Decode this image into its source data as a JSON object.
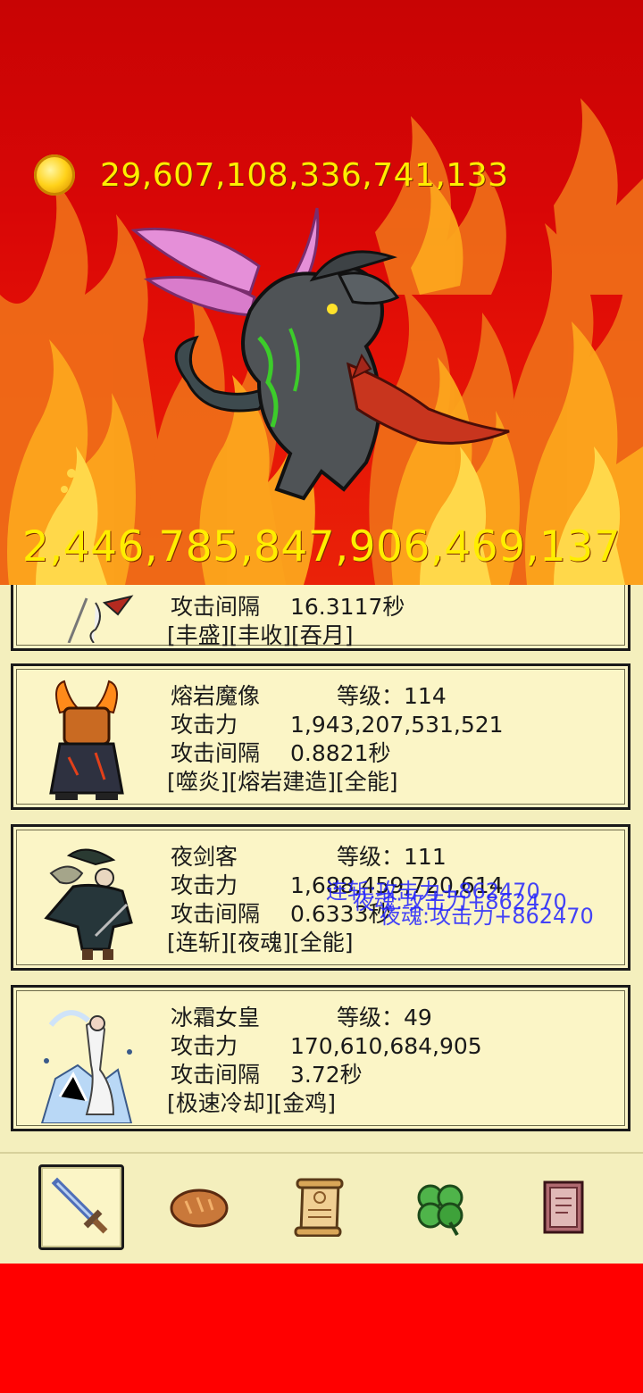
{
  "gold": {
    "icon": "gold-coin-icon",
    "value": "29,607,108,336,741,133"
  },
  "boss": {
    "hp": "2,446,785,847,906,469,137",
    "icon": "winged-demon-boss-icon"
  },
  "heroes": [
    {
      "name": "",
      "level": "",
      "attack": "",
      "interval_label": "攻击间隔",
      "interval": "16.3117秒",
      "tags": "[丰盛][丰收][吞月]",
      "icon": "reaper-hero-icon"
    },
    {
      "name": "熔岩魔像",
      "level_label": "等级：",
      "level": "114",
      "attack_label": "攻击力",
      "attack": "1,943,207,531,521",
      "interval_label": "攻击间隔",
      "interval": "0.8821秒",
      "tags": "[噬炎][熔岩建造][全能]",
      "icon": "lava-golem-icon"
    },
    {
      "name": "夜剑客",
      "level_label": "等级：",
      "level": "111",
      "attack_label": "攻击力",
      "attack": "1,688,459,720,614",
      "interval_label": "攻击间隔",
      "interval": "0.6333秒",
      "tags": "[连斩][夜魂][全能]",
      "icon": "night-swordsman-icon",
      "floating_texts": [
        "连斩:攻击力+862470",
        "夜魂:攻击力+862470",
        "夜魂:攻击力+862470"
      ]
    },
    {
      "name": "冰霜女皇",
      "level_label": "等级：",
      "level": "49",
      "attack_label": "攻击力",
      "attack": "170,610,684,905",
      "interval_label": "攻击间隔",
      "interval": "3.72秒",
      "tags": "[极速冷却][金鸡]",
      "icon": "frost-queen-icon"
    }
  ],
  "nav": [
    {
      "icon": "sword-icon",
      "active": true
    },
    {
      "icon": "bread-icon",
      "active": false
    },
    {
      "icon": "scroll-icon",
      "active": false
    },
    {
      "icon": "clover-icon",
      "active": false
    },
    {
      "icon": "book-icon",
      "active": false
    }
  ],
  "colors": {
    "gold_text": "#ffee00",
    "panel": "#fbf5c6",
    "floating_text": "#2323ff",
    "background": "#ff0000"
  }
}
